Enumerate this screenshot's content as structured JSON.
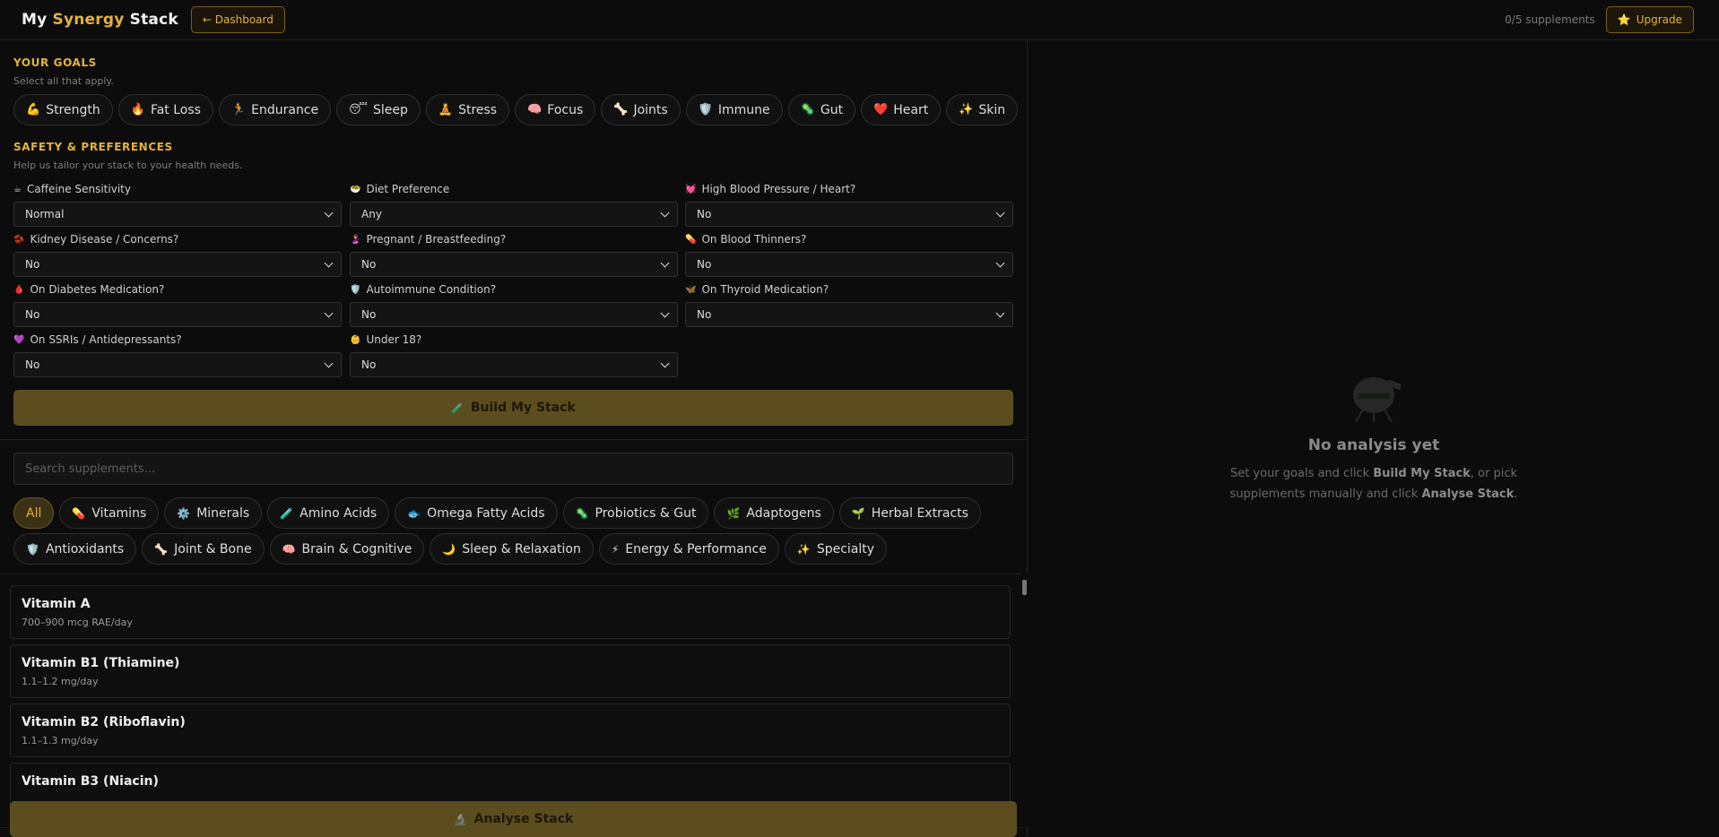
{
  "header": {
    "logo_prefix": "My ",
    "logo_accent": "Synergy",
    "logo_suffix": " Stack",
    "dashboard_label": "← Dashboard",
    "supplement_count": "0/5 supplements",
    "upgrade_label": "Upgrade"
  },
  "goals": {
    "title": "YOUR GOALS",
    "subtitle": "Select all that apply.",
    "items": [
      {
        "icon": "💪",
        "label": "Strength"
      },
      {
        "icon": "🔥",
        "label": "Fat Loss"
      },
      {
        "icon": "🏃",
        "label": "Endurance"
      },
      {
        "icon": "😴",
        "label": "Sleep"
      },
      {
        "icon": "🧘",
        "label": "Stress"
      },
      {
        "icon": "🧠",
        "label": "Focus"
      },
      {
        "icon": "🦴",
        "label": "Joints"
      },
      {
        "icon": "🛡️",
        "label": "Immune"
      },
      {
        "icon": "🦠",
        "label": "Gut"
      },
      {
        "icon": "❤️",
        "label": "Heart"
      },
      {
        "icon": "✨",
        "label": "Skin"
      }
    ]
  },
  "safety": {
    "title": "SAFETY & PREFERENCES",
    "subtitle": "Help us tailor your stack to your health needs.",
    "fields": [
      {
        "icon": "☕",
        "label": "Caffeine Sensitivity",
        "value": "Normal"
      },
      {
        "icon": "🥗",
        "label": "Diet Preference",
        "value": "Any"
      },
      {
        "icon": "💓",
        "label": "High Blood Pressure / Heart?",
        "value": "No"
      },
      {
        "icon": "🫘",
        "label": "Kidney Disease / Concerns?",
        "value": "No"
      },
      {
        "icon": "🤰",
        "label": "Pregnant / Breastfeeding?",
        "value": "No"
      },
      {
        "icon": "💊",
        "label": "On Blood Thinners?",
        "value": "No"
      },
      {
        "icon": "🩸",
        "label": "On Diabetes Medication?",
        "value": "No"
      },
      {
        "icon": "🛡️",
        "label": "Autoimmune Condition?",
        "value": "No"
      },
      {
        "icon": "🦋",
        "label": "On Thyroid Medication?",
        "value": "No"
      },
      {
        "icon": "💜",
        "label": "On SSRIs / Antidepressants?",
        "value": "No"
      },
      {
        "icon": "👶",
        "label": "Under 18?",
        "value": "No"
      }
    ],
    "build_label": "Build My Stack",
    "build_icon": "🧪"
  },
  "search": {
    "placeholder": "Search supplements..."
  },
  "categories": [
    {
      "icon": "",
      "label": "All",
      "active": true
    },
    {
      "icon": "💊",
      "label": "Vitamins"
    },
    {
      "icon": "⚙️",
      "label": "Minerals"
    },
    {
      "icon": "🧪",
      "label": "Amino Acids"
    },
    {
      "icon": "🐟",
      "label": "Omega Fatty Acids"
    },
    {
      "icon": "🦠",
      "label": "Probiotics & Gut"
    },
    {
      "icon": "🌿",
      "label": "Adaptogens"
    },
    {
      "icon": "🌱",
      "label": "Herbal Extracts"
    },
    {
      "icon": "🛡️",
      "label": "Antioxidants"
    },
    {
      "icon": "🦴",
      "label": "Joint & Bone"
    },
    {
      "icon": "🧠",
      "label": "Brain & Cognitive"
    },
    {
      "icon": "🌙",
      "label": "Sleep & Relaxation"
    },
    {
      "icon": "⚡",
      "label": "Energy & Performance"
    },
    {
      "icon": "✨",
      "label": "Specialty"
    }
  ],
  "supplements": [
    {
      "name": "Vitamin A",
      "dose": "700–900 mcg RAE/day"
    },
    {
      "name": "Vitamin B1 (Thiamine)",
      "dose": "1.1–1.2 mg/day"
    },
    {
      "name": "Vitamin B2 (Riboflavin)",
      "dose": "1.1–1.3 mg/day"
    },
    {
      "name": "Vitamin B3 (Niacin)",
      "dose": ""
    }
  ],
  "analyse": {
    "label": "Analyse Stack",
    "icon": "🔬"
  },
  "analysis_panel": {
    "title": "No analysis yet",
    "text_1": "Set your goals and click ",
    "text_bold_1": "Build My Stack",
    "text_2": ", or pick",
    "text_3": "supplements manually and click ",
    "text_bold_2": "Analyse Stack",
    "text_4": "."
  },
  "colors": {
    "accent": "#e3b23c",
    "background": "#0c0c0c",
    "button_bg": "#5c4d1f"
  }
}
